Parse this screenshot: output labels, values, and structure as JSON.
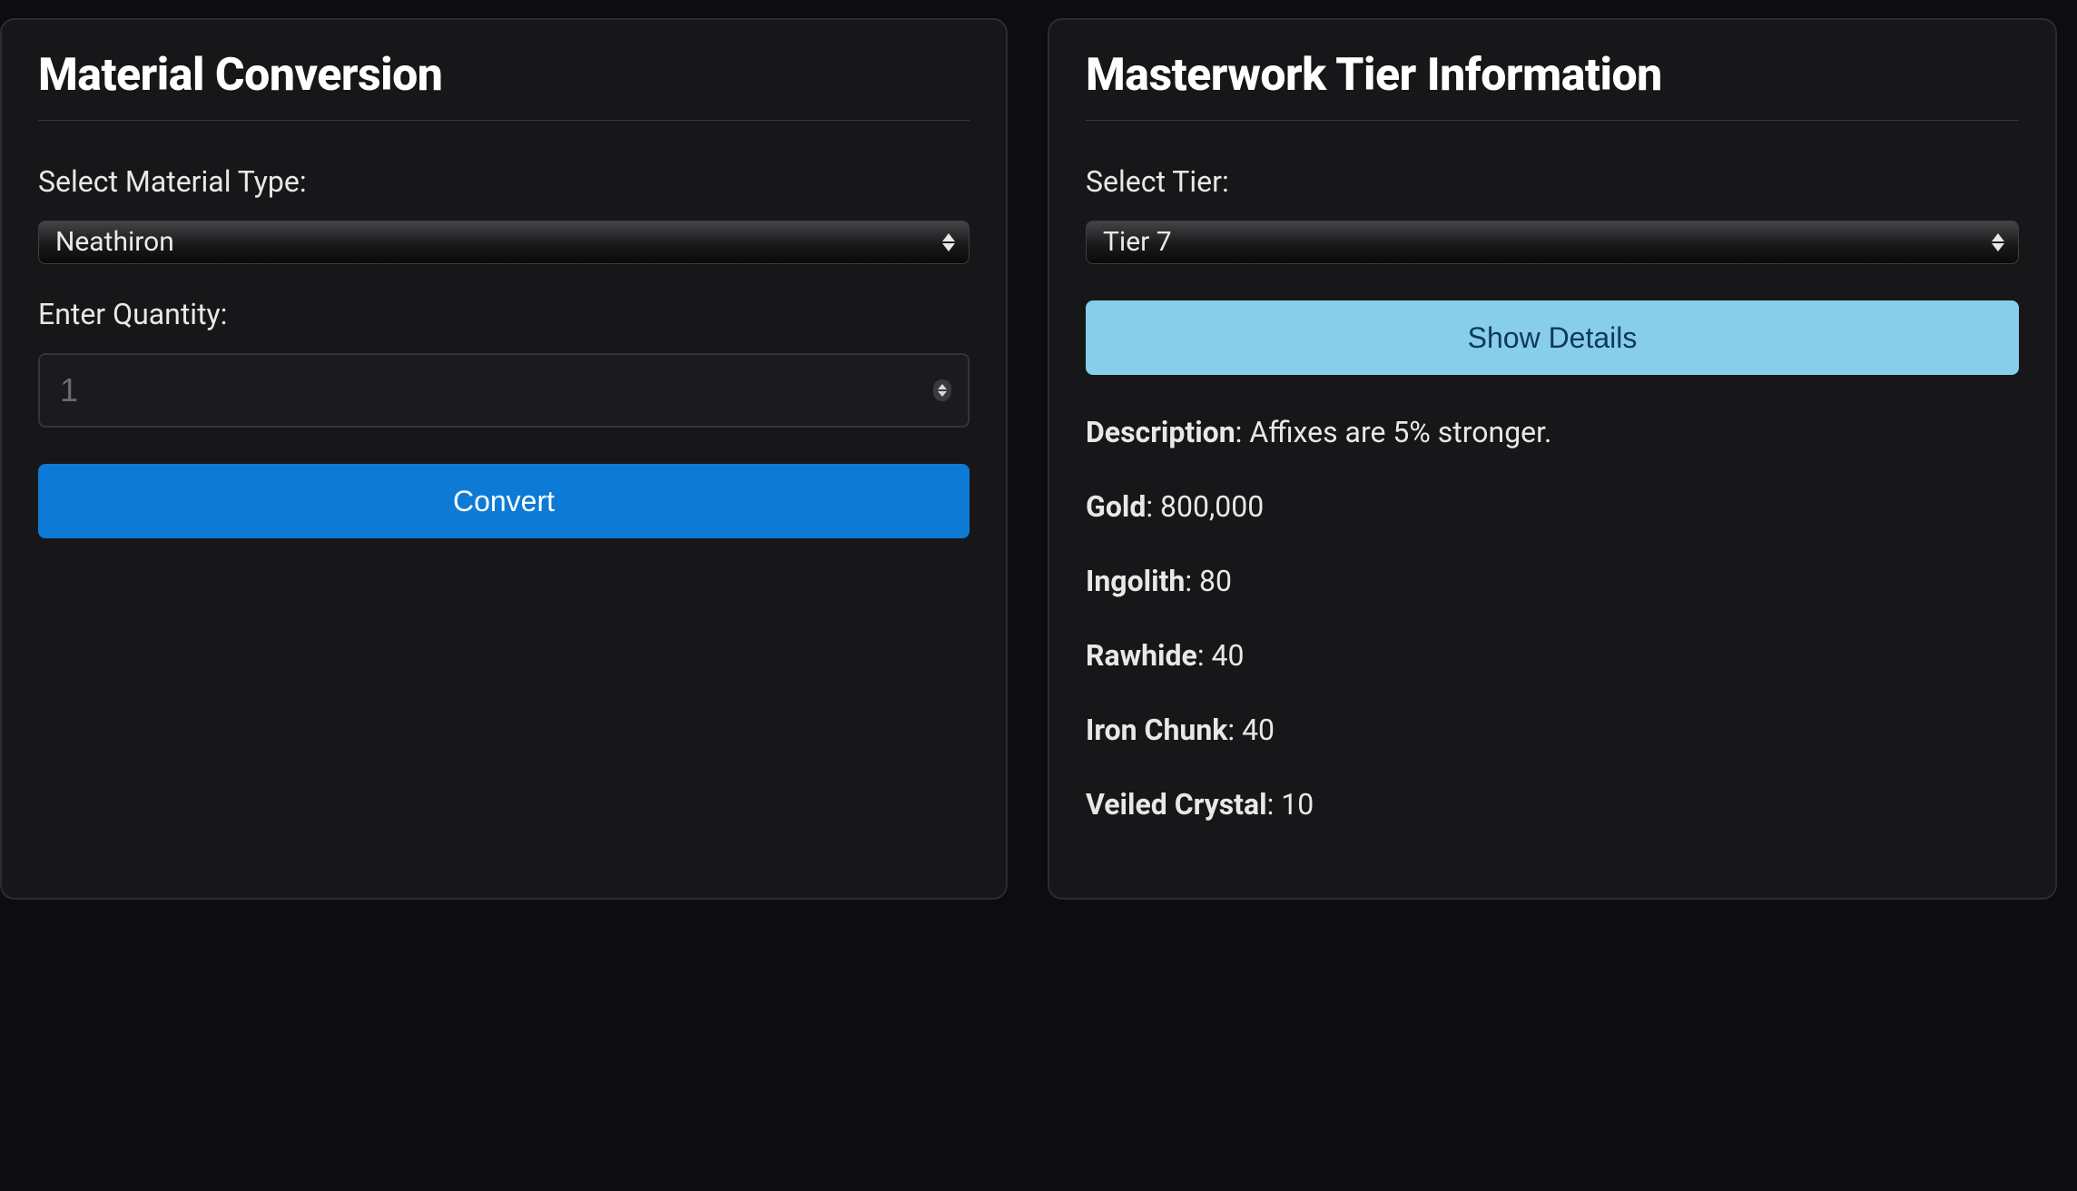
{
  "left": {
    "title": "Material Conversion",
    "material_label": "Select Material Type:",
    "material_selected": "Neathiron",
    "quantity_label": "Enter Quantity:",
    "quantity_placeholder": "1",
    "convert_label": "Convert"
  },
  "right": {
    "title": "Masterwork Tier Information",
    "tier_label": "Select Tier:",
    "tier_selected": "Tier 7",
    "show_details_label": "Show Details",
    "details": [
      {
        "label": "Description",
        "value": "Affixes are 5% stronger."
      },
      {
        "label": "Gold",
        "value": "800,000"
      },
      {
        "label": "Ingolith",
        "value": "80"
      },
      {
        "label": "Rawhide",
        "value": "40"
      },
      {
        "label": "Iron Chunk",
        "value": "40"
      },
      {
        "label": "Veiled Crystal",
        "value": "10"
      }
    ]
  }
}
